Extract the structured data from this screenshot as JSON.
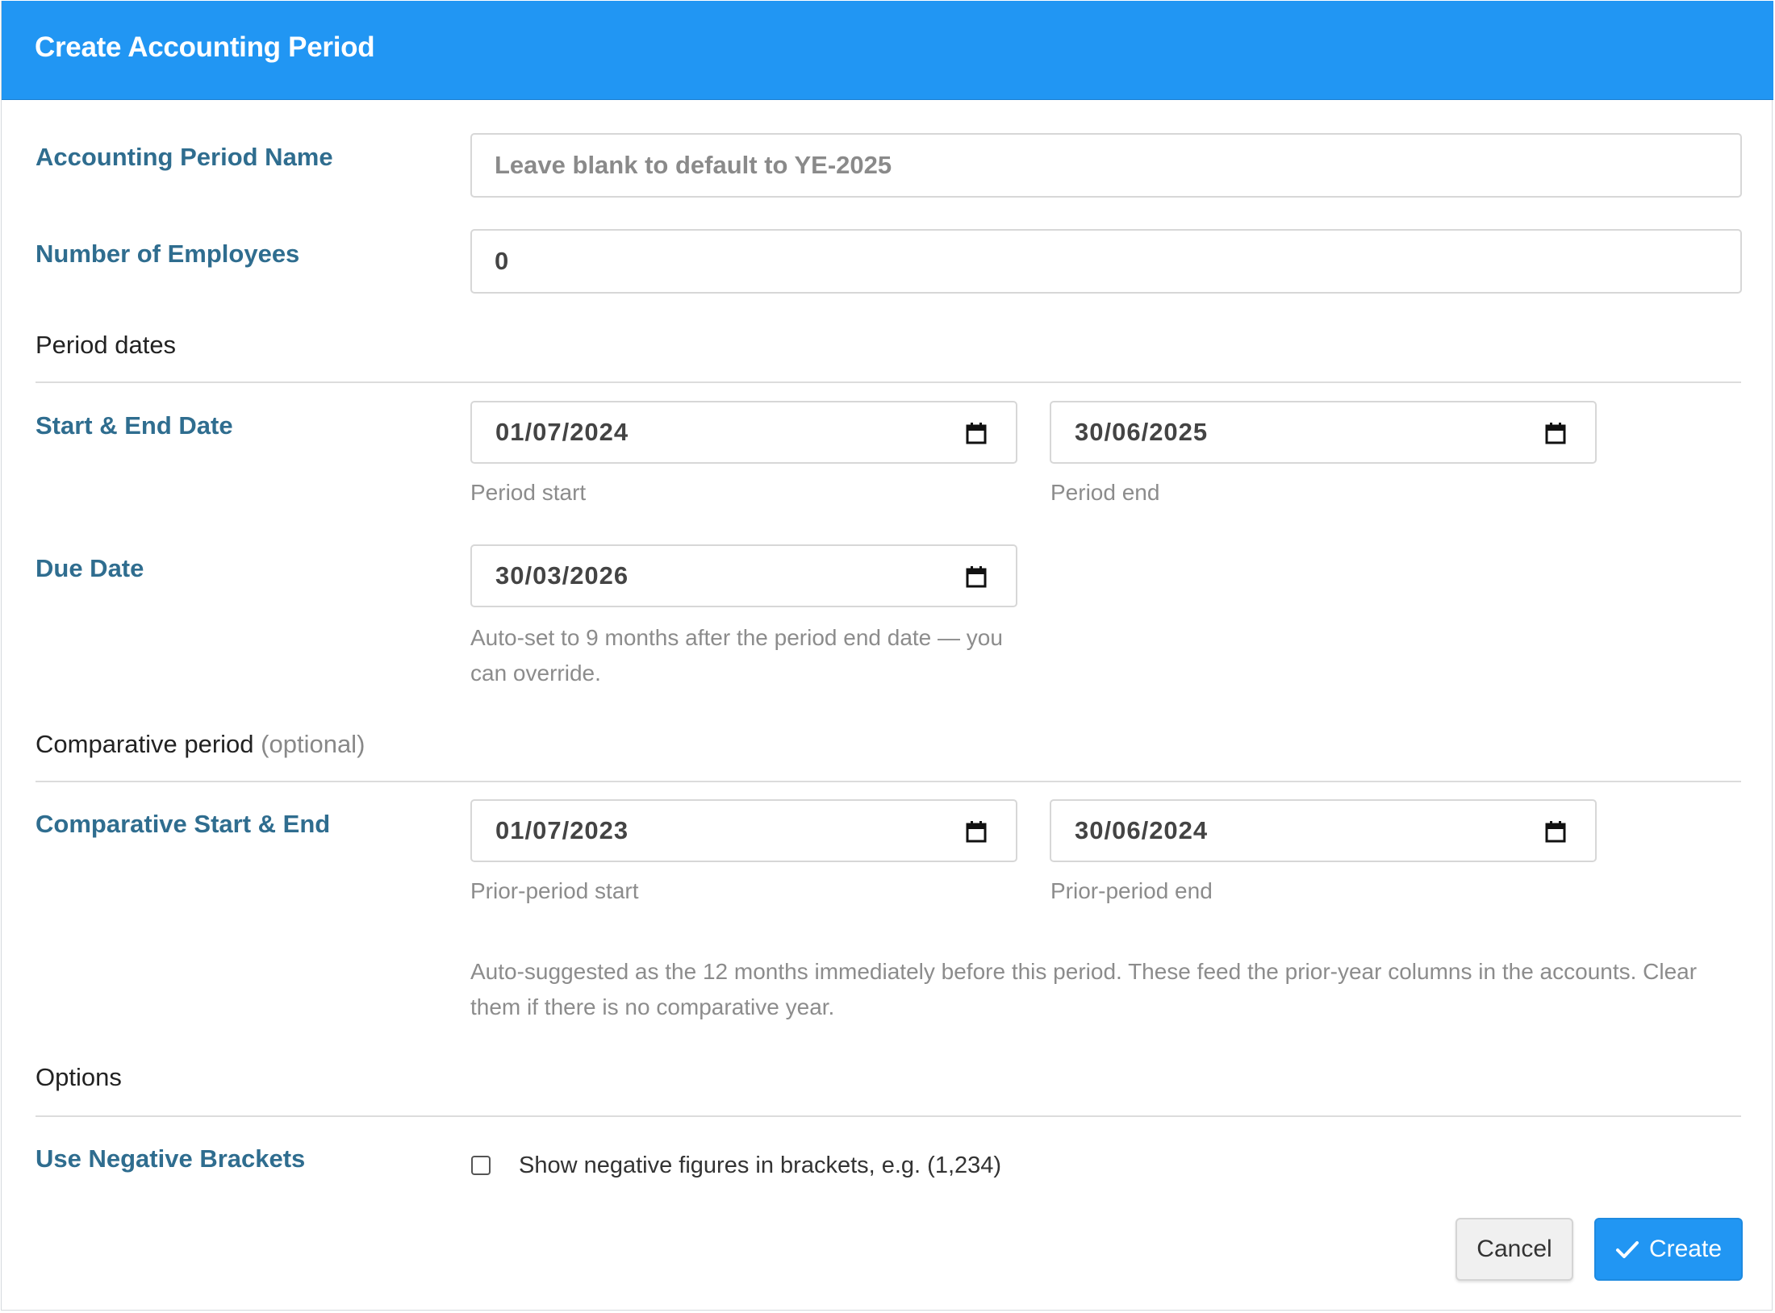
{
  "modal": {
    "title": "Create Accounting Period"
  },
  "fields": {
    "period_name": {
      "label": "Accounting Period Name",
      "value": "",
      "placeholder": "Leave blank to default to YE-2025"
    },
    "employees": {
      "label": "Number of Employees",
      "value": "0"
    }
  },
  "sections": {
    "period_dates": "Period dates",
    "comparative": "Comparative period",
    "comparative_optional": "(optional)",
    "options": "Options"
  },
  "period": {
    "label": "Start & End Date",
    "start": {
      "value": "01/07/2024",
      "help": "Period start"
    },
    "end": {
      "value": "30/06/2025",
      "help": "Period end"
    }
  },
  "due": {
    "label": "Due Date",
    "value": "30/03/2026",
    "help_line1": "Auto-set to 9 months after the period end date — you",
    "help_line2": "can override."
  },
  "comparative": {
    "label": "Comparative Start & End",
    "start": {
      "value": "01/07/2023",
      "help": "Prior-period start"
    },
    "end": {
      "value": "30/06/2024",
      "help": "Prior-period end"
    },
    "note_line1": "Auto-suggested as the 12 months immediately before this period. These feed the prior-year columns in the accounts. Clear",
    "note_line2": "them if there is no comparative year."
  },
  "options": {
    "negative_brackets": {
      "label": "Use Negative Brackets",
      "checkbox_label": "Show negative figures in brackets, e.g. (1,234)",
      "checked": false
    }
  },
  "buttons": {
    "cancel": "Cancel",
    "create": "Create"
  },
  "icons": {
    "date_picker": "calendar-icon",
    "create": "check-icon"
  },
  "colors": {
    "header": "#2196f3",
    "label": "#2f6d8f",
    "primary_button": "#2196f3"
  }
}
